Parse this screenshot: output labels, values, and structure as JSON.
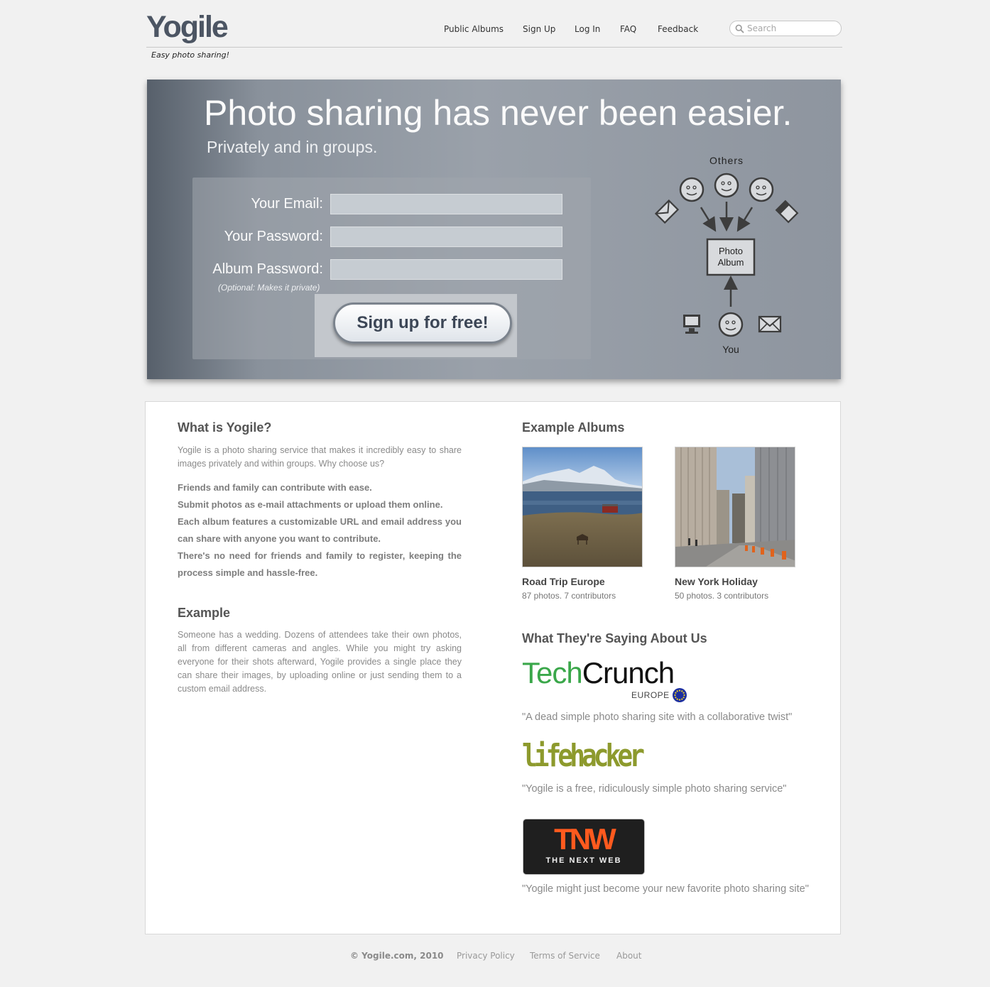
{
  "header": {
    "logo": "Yogile",
    "tagline": "Easy photo sharing!",
    "nav": [
      "Public Albums",
      "Sign Up",
      "Log In",
      "FAQ",
      "Feedback"
    ],
    "search_placeholder": "Search"
  },
  "hero": {
    "title": "Photo sharing has never been easier.",
    "subtitle": "Privately and in groups.",
    "form": {
      "email_label": "Your Email:",
      "password_label": "Your Password:",
      "album_password_label": "Album Password:",
      "optional_note": "(Optional: Makes it private)",
      "email_value": "",
      "password_value": "",
      "album_password_value": ""
    },
    "signup_button": "Sign up for free!",
    "diagram": {
      "others_label": "Others",
      "album_label_line1": "Photo",
      "album_label_line2": "Album",
      "you_label": "You"
    }
  },
  "about": {
    "heading": "What is Yogile?",
    "intro": "Yogile is a photo sharing service that makes it incredibly easy to share images privately and within groups. Why choose us?",
    "features": [
      "Friends and family can contribute with ease.",
      "Submit photos as e-mail attachments or upload them online.",
      "Each album features a customizable URL and email address you can share with anyone you want to contribute.",
      "There's no need for friends and family to register, keeping the process simple and hassle-free."
    ],
    "example_heading": "Example",
    "example_text": "Someone has a wedding. Dozens of attendees take their own photos, all from different cameras and angles. While you might try asking everyone for their shots afterward, Yogile provides a single place they can share their images, by uploading online or just sending them to a custom email address."
  },
  "albums": {
    "heading": "Example Albums",
    "items": [
      {
        "title": "Road Trip Europe",
        "meta": "87 photos. 7 contributors"
      },
      {
        "title": "New York Holiday",
        "meta": "50 photos. 3 contributors"
      }
    ]
  },
  "press": {
    "heading": "What They're Saying About Us",
    "items": [
      {
        "logo_main": "Tech",
        "logo_main2": "Crunch",
        "logo_sub": "EUROPE",
        "quote": "\"A dead simple photo sharing site with a collaborative twist\""
      },
      {
        "logo_main": "lifehacker",
        "quote": "\"Yogile is a free, ridiculously simple photo sharing service\""
      },
      {
        "logo_main": "TNW",
        "logo_sub": "THE NEXT WEB",
        "quote": "\"Yogile might just become your new favorite photo sharing site\""
      }
    ]
  },
  "footer": {
    "copyright": "© Yogile.com, 2010",
    "links": [
      "Privacy Policy",
      "Terms of Service",
      "About"
    ]
  },
  "colors": {
    "techcrunch_green": "#3aa74a",
    "lifehacker_olive": "#8d9a2d",
    "tnw_orange": "#ff5a1e"
  }
}
